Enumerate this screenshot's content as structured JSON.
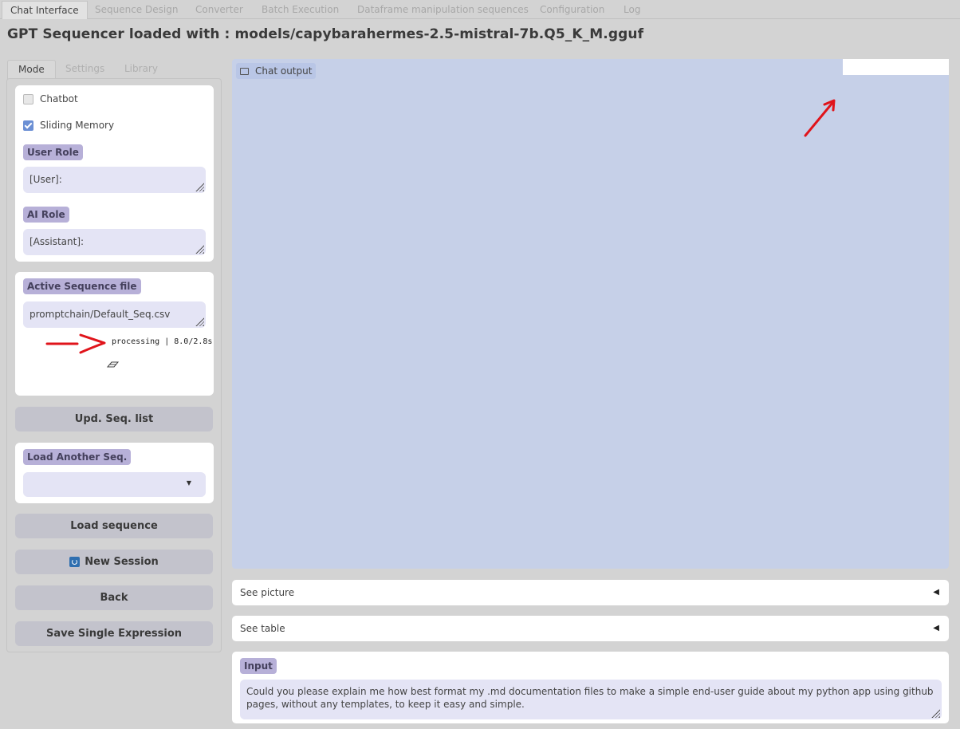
{
  "top_tabs": [
    {
      "label": "Chat Interface"
    },
    {
      "label": "Sequence Design"
    },
    {
      "label": "Converter"
    },
    {
      "label": "Batch Execution"
    },
    {
      "label": "Dataframe manipulation sequences"
    },
    {
      "label": "Configuration"
    },
    {
      "label": "Log"
    }
  ],
  "title": "GPT Sequencer loaded with : models/capybarahermes-2.5-mistral-7b.Q5_K_M.gguf",
  "sub_tabs": [
    {
      "label": "Mode"
    },
    {
      "label": "Settings"
    },
    {
      "label": "Library"
    }
  ],
  "mode": {
    "chatbot": {
      "label": "Chatbot",
      "checked": false
    },
    "sliding_memory": {
      "label": "Sliding Memory",
      "checked": true
    },
    "user_role": {
      "label": "User Role",
      "value": "[User]:"
    },
    "ai_role": {
      "label": "AI Role",
      "value": "[Assistant]:"
    }
  },
  "sequence": {
    "label": "Active Sequence file",
    "value": "promptchain/Default_Seq.csv",
    "status": "processing | 8.0/2.8s"
  },
  "buttons": {
    "update": "Upd. Seq. list",
    "load": "Load sequence",
    "new_session": "New Session",
    "back": "Back",
    "save": "Save Single Expression"
  },
  "load_another": {
    "label": "Load Another Seq.",
    "value": ""
  },
  "chat": {
    "label": "Chat output"
  },
  "accordions": {
    "picture": "See picture",
    "table": "See table"
  },
  "input": {
    "label": "Input",
    "value": "Could you please explain me how best format my .md documentation files to make a simple end-user guide about my python app using github pages, without any templates, to keep it easy and simple."
  },
  "colors": {
    "accent_pill": "#b7b0d8",
    "chat_bg": "#c6d0e8",
    "annotation_red": "#e0141b"
  }
}
